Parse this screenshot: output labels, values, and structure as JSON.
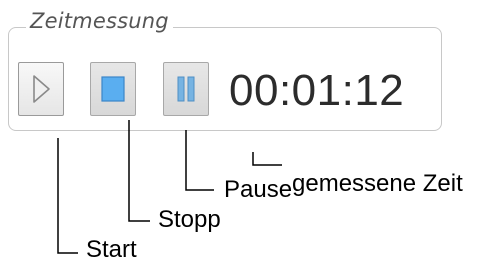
{
  "timer": {
    "group_title": "Zeitmessung",
    "elapsed_time": "00:01:12",
    "buttons": {
      "start_icon": "play-icon",
      "stop_icon": "stop-icon",
      "pause_icon": "pause-icon"
    }
  },
  "annotations": {
    "elapsed_time": "gemessene Zeit",
    "pause": "Pause",
    "stop": "Stopp",
    "start": "Start"
  },
  "colors": {
    "stop_fill": "#5aaef0",
    "pause_fill": "#76b3e2",
    "play_fill": "#f0f0f0",
    "play_stroke": "#8a8a8a",
    "group_border": "#c8c8c8"
  }
}
